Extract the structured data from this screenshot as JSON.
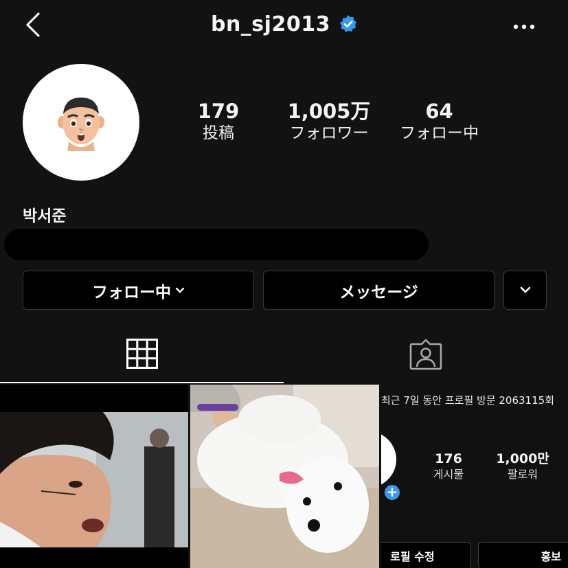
{
  "header": {
    "username": "bn_sj2013",
    "back_icon": "chevron-left-icon",
    "verified_icon": "verified-badge-icon",
    "more_icon": "more-horizontal-icon",
    "verified_color": "#3897f0"
  },
  "profile": {
    "avatar_icon": "memoji-avatar-icon",
    "display_name": "박서준",
    "stats": {
      "posts": {
        "value": "179",
        "label": "投稿"
      },
      "followers": {
        "value": "1,005万",
        "label": "フォロワー"
      },
      "following": {
        "value": "64",
        "label": "フォロー中"
      }
    }
  },
  "actions": {
    "follow_label": "フォロー中",
    "message_label": "メッセージ",
    "dropdown_icon": "chevron-down-icon"
  },
  "tabs": [
    {
      "name": "grid",
      "icon": "grid-icon",
      "active": true
    },
    {
      "name": "tagged",
      "icon": "tagged-person-icon",
      "active": false
    }
  ],
  "posts": [
    {
      "kind": "photo",
      "icon": "photo-person-closeup"
    },
    {
      "kind": "photo",
      "icon": "photo-white-dog"
    },
    {
      "kind": "screenshot",
      "banner": "최근 7일 동안 프로필 방문 2063115회",
      "stats": [
        {
          "value": "176",
          "label": "게시물"
        },
        {
          "value": "1,000만",
          "label": "팔로워"
        }
      ],
      "buttons": [
        "로필 수정",
        "홍보"
      ]
    }
  ],
  "colors": {
    "background": "#121212",
    "button_bg": "#000000",
    "button_border": "#3a3a3a",
    "text": "#f5f5f5"
  }
}
